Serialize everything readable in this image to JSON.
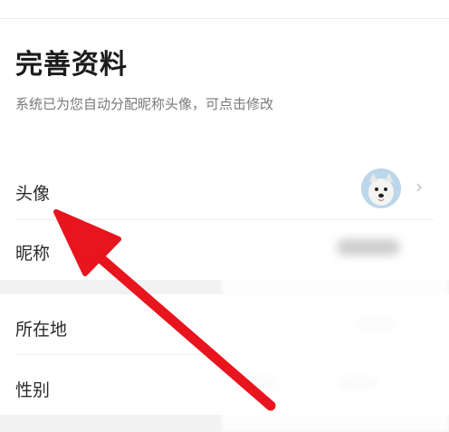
{
  "header": {
    "title": "完善资料",
    "subtitle": "系统已为您自动分配昵称头像，可点击修改"
  },
  "rows": {
    "avatar": {
      "label": "头像",
      "icon": "dog-avatar-icon"
    },
    "nickname": {
      "label": "昵称"
    },
    "location": {
      "label": "所在地"
    },
    "gender": {
      "label": "性别"
    }
  },
  "colors": {
    "annotation_arrow": "#e8141e",
    "section_gap": "#f2f2f2"
  }
}
